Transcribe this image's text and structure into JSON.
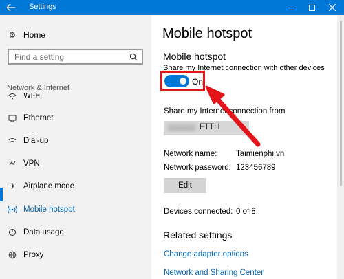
{
  "window": {
    "title": "Settings",
    "back_icon": "back-arrow-icon",
    "controls": [
      "minimize-icon",
      "maximize-icon",
      "close-icon"
    ]
  },
  "sidebar": {
    "home": {
      "label": "Home",
      "icon": "gear-icon"
    },
    "search": {
      "placeholder": "Find a setting",
      "icon": "search-icon"
    },
    "section": "Network & Internet",
    "items": [
      {
        "label": "Wi-Fi",
        "icon": "wifi-icon"
      },
      {
        "label": "Ethernet",
        "icon": "ethernet-icon"
      },
      {
        "label": "Dial-up",
        "icon": "dialup-icon"
      },
      {
        "label": "VPN",
        "icon": "vpn-icon"
      },
      {
        "label": "Airplane mode",
        "icon": "airplane-icon"
      },
      {
        "label": "Mobile hotspot",
        "icon": "hotspot-icon"
      },
      {
        "label": "Data usage",
        "icon": "data-usage-icon"
      },
      {
        "label": "Proxy",
        "icon": "globe-icon"
      }
    ],
    "active_item": "Mobile hotspot"
  },
  "main": {
    "title": "Mobile hotspot",
    "section_title": "Mobile hotspot",
    "share_description": "Share my Internet connection with other devices",
    "toggle": {
      "state_label": "On",
      "on": true
    },
    "share_from_label": "Share my Internet connection from",
    "share_from_value": "FTTH",
    "network_name_label": "Network name:",
    "network_name_value": "Taimienphi.vn",
    "network_password_label": "Network password:",
    "network_password_value": "123456789",
    "edit_button": "Edit",
    "devices_connected_label": "Devices connected:",
    "devices_connected_value": "0 of 8",
    "related_title": "Related settings",
    "related_links": [
      "Change adapter options",
      "Network and Sharing Center"
    ]
  },
  "colors": {
    "accent": "#0078d7",
    "link": "#0063b1",
    "annotation": "#e3141a",
    "sidebar_bg": "#f2f2f2"
  }
}
